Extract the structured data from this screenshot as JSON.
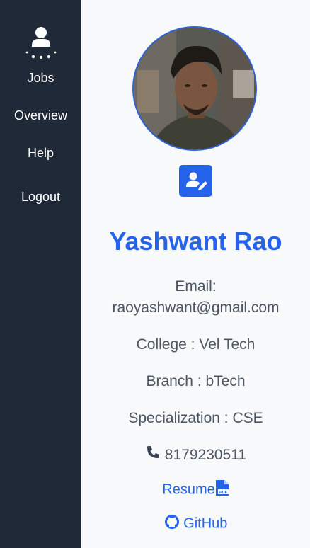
{
  "sidebar": {
    "items": [
      {
        "label": "Jobs"
      },
      {
        "label": "Overview"
      },
      {
        "label": "Help"
      },
      {
        "label": "Logout"
      }
    ]
  },
  "profile": {
    "name": "Yashwant Rao",
    "email_label": "Email:",
    "email": "raoyashwant@gmail.com",
    "college": "College : Vel Tech",
    "branch": "Branch : bTech",
    "specialization": "Specialization : CSE",
    "phone": "8179230511",
    "resume_label": "Resume",
    "github_label": "GitHub"
  },
  "colors": {
    "sidebar_bg": "#1f2937",
    "accent": "#2563eb",
    "text": "#4b5563"
  },
  "icons": [
    "user-icon",
    "edit-profile-icon",
    "phone-icon",
    "pdf-icon",
    "github-icon"
  ]
}
